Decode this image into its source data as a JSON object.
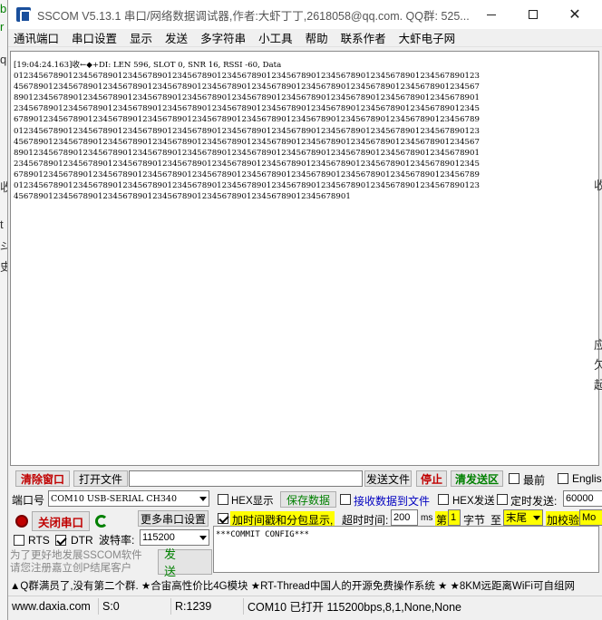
{
  "background": {
    "left_chars": [
      "b",
      "r",
      "q",
      "收",
      "t",
      "斗",
      "史"
    ],
    "right_chars": [
      "收",
      "应",
      "欠",
      "起"
    ]
  },
  "window": {
    "title": "SSCOM V5.13.1 串口/网络数据调试器,作者:大虾丁丁,2618058@qq.com. QQ群: 525..."
  },
  "menu": [
    "通讯端口",
    "串口设置",
    "显示",
    "发送",
    "多字符串",
    "小工具",
    "帮助",
    "联系作者",
    "大虾电子网"
  ],
  "receive": {
    "lines": [
      "[19:04:24.163]收←◆+DI: LEN 596, SLOT 0, SNR 16, RSSI -60, Data",
      "0123456789012345678901234567890123456789012345678901234567890123456789012345678901234567890123",
      "4567890123456789012345678901234567890123456789012345678901234567890123456789012345678901234567",
      "8901234567890123456789012345678901234567890123456789012345678901234567890123456789012345678901",
      "2345678901234567890123456789012345678901234567890123456789012345678901234567890123456789012345",
      "6789012345678901234567890123456789012345678901234567890123456789012345678901234567890123456789",
      "0123456789012345678901234567890123456789012345678901234567890123456789012345678901234567890123",
      "4567890123456789012345678901234567890123456789012345678901234567890123456789012345678901234567",
      "8901234567890123456789012345678901234567890123456789012345678901234567890123456789012345678901",
      "2345678901234567890123456789012345678901234567890123456789012345678901234567890123456789012345",
      "6789012345678901234567890123456789012345678901234567890123456789012345678901234567890123456789",
      "0123456789012345678901234567890123456789012345678901234567890123456789012345678901234567890123",
      "45678901234567890123456789012345678901234567890123456789012345678901"
    ]
  },
  "row1": {
    "clear": "清除窗口",
    "open_file": "打开文件",
    "send_file": "发送文件",
    "stop": "停止",
    "clear_send": "清发送区",
    "last": "最前",
    "english": "English"
  },
  "row2": {
    "port_label": "端口号",
    "port_value": "COM10 USB-SERIAL CH340",
    "hex_show": "HEX显示",
    "save_data": "保存数据",
    "recv_to_file": "接收数据到文件",
    "hex_send": "HEX发送",
    "timed_send": "定时发送:",
    "timed_value": "60000"
  },
  "row3": {
    "close_port": "关闭串口",
    "more_settings": "更多串口设置",
    "timestamp": "加时间戳和分包显示,",
    "timeout_label": "超时时间:",
    "timeout_value": "200",
    "ms": "ms",
    "nth": "第",
    "nth_value": "1",
    "byte": "字节",
    "to": "至",
    "end": "末尾",
    "checksum": "加校验",
    "checksum_value": "Mo"
  },
  "row4": {
    "rts": "RTS",
    "dtr": "DTR",
    "baud_label": "波特率:",
    "baud_value": "115200"
  },
  "send": {
    "text": "***COMMIT CONFIG***",
    "button": "发 送",
    "promo1": "为了更好地发展SSCOM软件",
    "promo2": "请您注册嘉立创P结尾客户"
  },
  "ticker": "▲Q群满员了,没有第二个群. ★合宙高性价比4G模块 ★RT-Thread中国人的开源免费操作系统 ★ ★8KM远距离WiFi可自组网",
  "status": {
    "site": "www.daxia.com",
    "sent": "S:0",
    "received": "R:1239",
    "port_status": "COM10 已打开  115200bps,8,1,None,None"
  },
  "colors": {
    "accent_red": "#c00000",
    "accent_green": "#008000",
    "highlight_yellow": "#ffff00"
  }
}
